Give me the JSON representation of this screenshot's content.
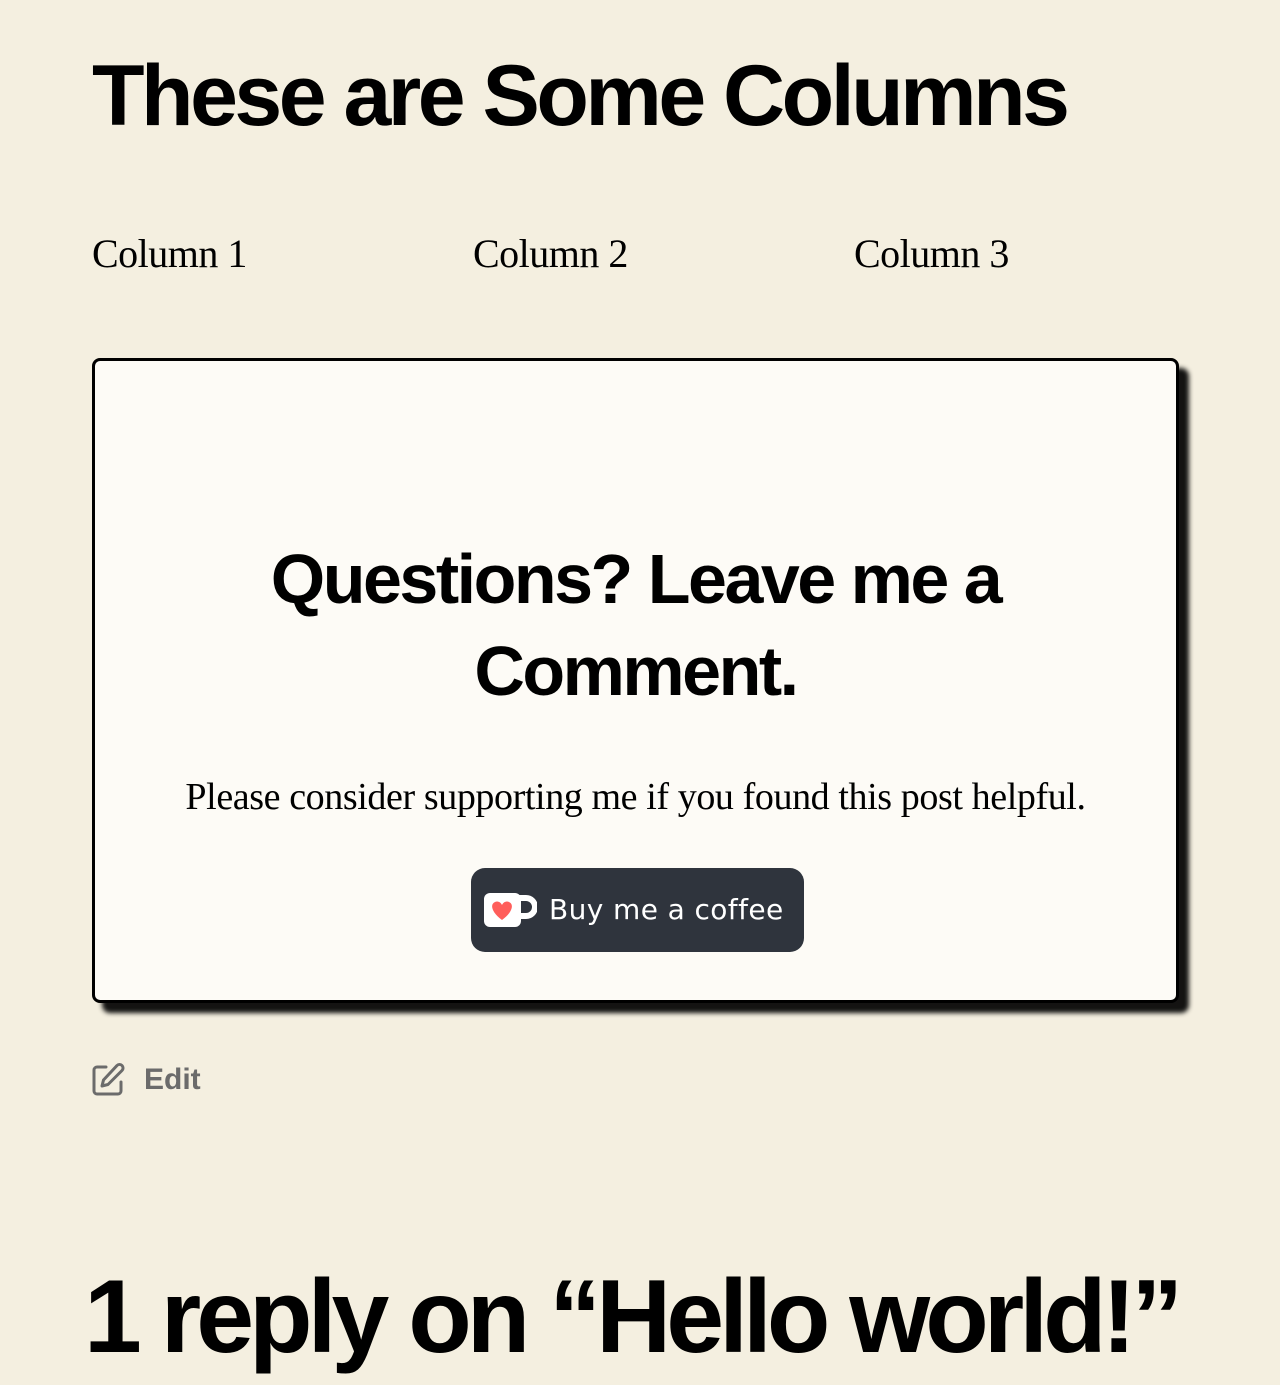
{
  "page": {
    "heading": "These are Some Columns"
  },
  "columns": [
    {
      "label": "Column 1"
    },
    {
      "label": "Column 2"
    },
    {
      "label": "Column 3"
    }
  ],
  "cta": {
    "heading": "Questions? Leave me a Comment.",
    "text": "Please consider supporting me if you found this post helpful.",
    "button_label": "Buy me a coffee",
    "button_icon": "ko-fi-cup-heart-icon"
  },
  "edit": {
    "label": "Edit",
    "icon": "edit-icon"
  },
  "comments": {
    "heading": "1 reply on “Hello world!”"
  },
  "colors": {
    "background": "#f4efe0",
    "card_background": "#fdfbf6",
    "button_background": "#2f343d",
    "heart": "#ff5e5b",
    "muted_text": "#6b6b6b"
  }
}
